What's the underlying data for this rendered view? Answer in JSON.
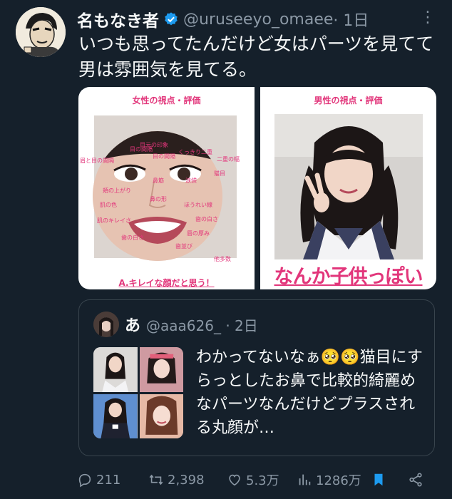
{
  "tweet": {
    "name": "名もなき者",
    "handle": "@uruseeyo_omaee",
    "time": "· 1日",
    "more": "⋮",
    "text": "いつも思ってたんだけど女はパーツを見てて男は雰囲気を見てる。"
  },
  "media": {
    "left_title": "女性の視点・評価",
    "left_labels": [
      "目元の印象",
      "二重の幅",
      "くっきり二重",
      "目の間隔",
      "眉と目の間隔",
      "涙袋",
      "鼻筋",
      "頬の上がり",
      "鼻の形",
      "ほうれい線",
      "肌の色",
      "歯の白さ",
      "肌のキレイさ",
      "唇の厚み",
      "歯の白さ",
      "歯並び",
      "他多数",
      "目の間隔",
      "猫目"
    ],
    "left_caption": "A.キレイな顔だと思う！",
    "right_title": "男性の視点・評価",
    "right_caption": "なんか子供っぽい"
  },
  "quote": {
    "name": "あ",
    "handle": "@aaa626_ · 2日",
    "text": "わかってないなぁ🥺🥺猫目にすらっとしたお鼻で比較的綺麗めなパーツなんだけどプラスされる丸顔が…"
  },
  "actions": {
    "replies": "211",
    "retweets": "2,398",
    "likes": "5.3万",
    "views": "1286万"
  },
  "colors": {
    "background": "#15202b",
    "accent_pink": "#e2367b",
    "verified_blue": "#1d9bf0",
    "muted": "#8b98a5"
  }
}
